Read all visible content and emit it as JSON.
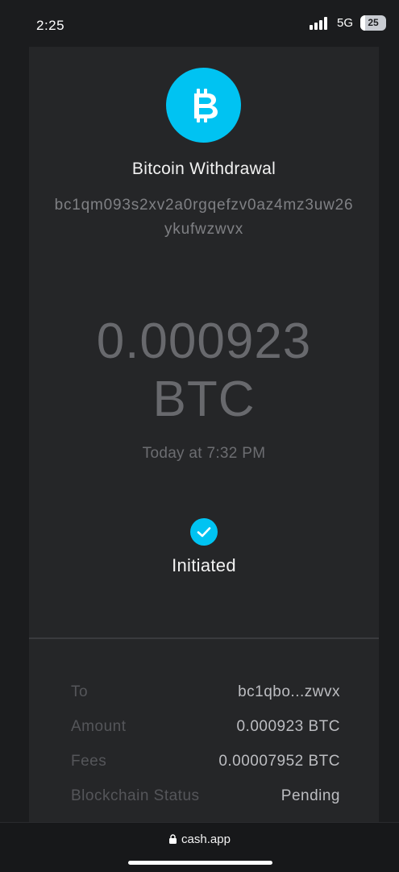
{
  "status_bar": {
    "time": "2:25",
    "network": "5G",
    "battery": "25"
  },
  "transaction": {
    "title": "Bitcoin Withdrawal",
    "address": "bc1qm093s2xv2a0rgqefzv0az4mz3uw26ykufwzwvx",
    "amount_value": "0.000923",
    "amount_unit": "BTC",
    "date": "Today at 7:32 PM",
    "status": "Initiated"
  },
  "details": [
    {
      "label": "To",
      "value": "bc1qbo...zwvx"
    },
    {
      "label": "Amount",
      "value": "0.000923 BTC"
    },
    {
      "label": "Fees",
      "value": "0.00007952 BTC"
    },
    {
      "label": "Blockchain Status",
      "value": "Pending"
    }
  ],
  "browser": {
    "url": "cash.app"
  },
  "colors": {
    "accent": "#00c3f2",
    "background": "#1b1c1e",
    "card": "#252628"
  },
  "icons": {
    "logo": "bitcoin-icon",
    "status": "checkmark-icon",
    "url": "lock-icon"
  }
}
